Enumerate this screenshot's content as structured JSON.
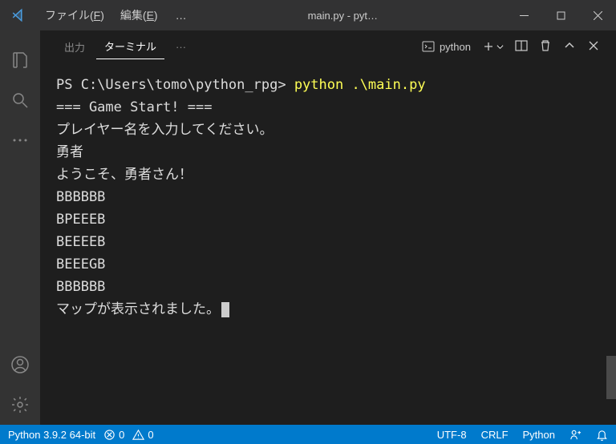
{
  "titlebar": {
    "menu_file": "ファイル(F)",
    "menu_edit": "編集(E)",
    "ellipsis": "…",
    "title": "main.py - pyt…"
  },
  "panel": {
    "tab_output": "出力",
    "tab_terminal": "ターミナル",
    "ellipsis": "···",
    "shell_label": "python"
  },
  "terminal": {
    "prompt": "PS C:\\Users\\tomo\\python_rpg> ",
    "command": "python .\\main.py",
    "lines": [
      "=== Game Start! ===",
      "プレイヤー名を入力してください。",
      "勇者",
      "ようこそ、勇者さん！",
      "BBBBBB",
      "BPEEEB",
      "BEEEEB",
      "BEEEGB",
      "BBBBBB",
      "マップが表示されました。"
    ]
  },
  "status": {
    "python_version": "Python 3.9.2 64-bit",
    "errors": "0",
    "warnings": "0",
    "encoding": "UTF-8",
    "eol": "CRLF",
    "lang": "Python"
  }
}
